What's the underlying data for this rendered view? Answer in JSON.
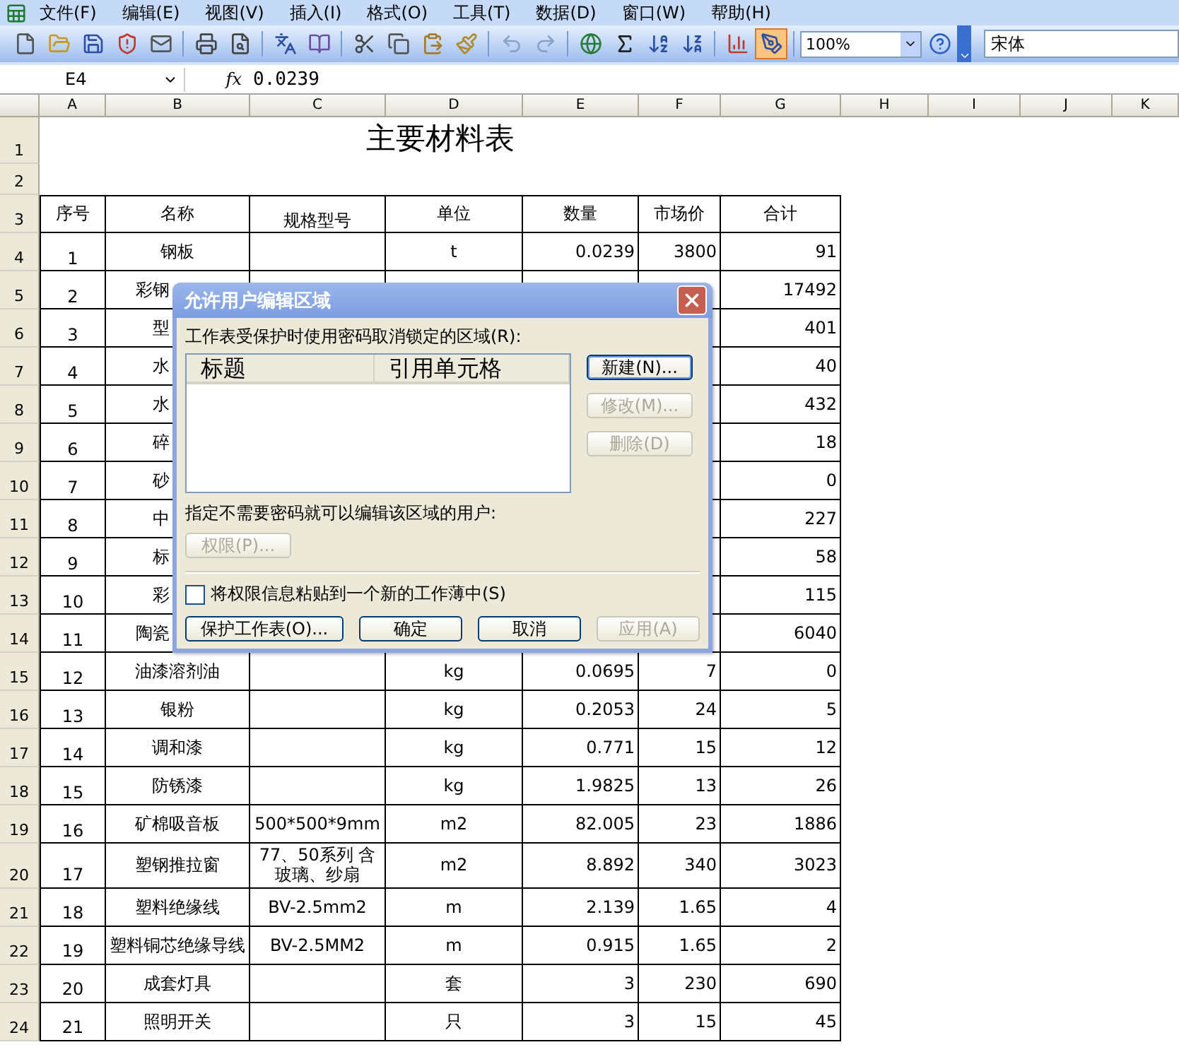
{
  "menu": [
    "文件(F)",
    "编辑(E)",
    "视图(V)",
    "插入(I)",
    "格式(O)",
    "工具(T)",
    "数据(D)",
    "窗口(W)",
    "帮助(H)"
  ],
  "toolbar": {
    "tools": [
      {
        "kind": "new",
        "pressed": false
      },
      {
        "kind": "open",
        "pressed": false
      },
      {
        "kind": "save",
        "pressed": false
      },
      {
        "kind": "permission",
        "pressed": false
      },
      {
        "kind": "mail",
        "pressed": false
      },
      {
        "kind": "print",
        "pressed": false
      },
      {
        "kind": "preview",
        "pressed": false
      },
      {
        "kind": "spelling",
        "pressed": false
      },
      {
        "kind": "research",
        "pressed": false
      },
      {
        "kind": "cut",
        "pressed": false
      },
      {
        "kind": "copy",
        "pressed": false
      },
      {
        "kind": "paste",
        "pressed": false
      },
      {
        "kind": "painter",
        "pressed": false
      },
      {
        "kind": "undo",
        "pressed": false
      },
      {
        "kind": "redo",
        "pressed": false
      },
      {
        "kind": "link",
        "pressed": false
      },
      {
        "kind": "sum",
        "pressed": false
      },
      {
        "kind": "sort_asc",
        "pressed": false
      },
      {
        "kind": "sort_desc",
        "pressed": false
      },
      {
        "kind": "chart",
        "pressed": false
      },
      {
        "kind": "drawing",
        "pressed": true
      }
    ],
    "zoom": "100%",
    "font": "宋体"
  },
  "formula_bar": {
    "cell": "E4",
    "function_label": "fx",
    "value": "0.0239"
  },
  "sheet": {
    "columns": [
      "A",
      "B",
      "C",
      "D",
      "E",
      "F",
      "G",
      "H",
      "I",
      "J",
      "K"
    ],
    "title": {
      "row": "1",
      "text": "主要材料表"
    },
    "blank_row": {
      "row": "2"
    },
    "header": {
      "row": "3",
      "cells": [
        "序号",
        "名称",
        "规格型号",
        "单位",
        "数量",
        "市场价",
        "合计"
      ]
    },
    "rows": [
      {
        "row": "4",
        "covered": false,
        "cells": [
          "1",
          "钢板",
          null,
          "t",
          "0.0239",
          "3800",
          "91"
        ]
      },
      {
        "row": "5",
        "covered": true,
        "cells": [
          "2",
          "彩钢",
          null,
          null,
          null,
          null,
          "17492"
        ]
      },
      {
        "row": "6",
        "covered": true,
        "cells": [
          "3",
          "型",
          null,
          null,
          null,
          null,
          "401"
        ]
      },
      {
        "row": "7",
        "covered": true,
        "cells": [
          "4",
          "水",
          null,
          null,
          null,
          null,
          "40"
        ]
      },
      {
        "row": "8",
        "covered": true,
        "cells": [
          "5",
          "水",
          null,
          null,
          null,
          null,
          "432"
        ]
      },
      {
        "row": "9",
        "covered": true,
        "cells": [
          "6",
          "碎",
          null,
          null,
          null,
          null,
          "18"
        ]
      },
      {
        "row": "10",
        "covered": true,
        "cells": [
          "7",
          "砂",
          null,
          null,
          null,
          null,
          "0"
        ]
      },
      {
        "row": "11",
        "covered": true,
        "cells": [
          "8",
          "中",
          null,
          null,
          null,
          null,
          "227"
        ]
      },
      {
        "row": "12",
        "covered": true,
        "cells": [
          "9",
          "标",
          null,
          null,
          null,
          null,
          "58"
        ]
      },
      {
        "row": "13",
        "covered": true,
        "cells": [
          "10",
          "彩",
          null,
          null,
          null,
          null,
          "115"
        ]
      },
      {
        "row": "14",
        "covered": true,
        "cells": [
          "11",
          "陶瓷",
          null,
          null,
          null,
          null,
          "6040"
        ]
      },
      {
        "row": "15",
        "covered": false,
        "cells": [
          "12",
          "油漆溶剂油",
          null,
          "kg",
          "0.0695",
          "7",
          "0"
        ]
      },
      {
        "row": "16",
        "covered": false,
        "cells": [
          "13",
          "银粉",
          null,
          "kg",
          "0.2053",
          "24",
          "5"
        ]
      },
      {
        "row": "17",
        "covered": false,
        "cells": [
          "14",
          "调和漆",
          null,
          "kg",
          "0.771",
          "15",
          "12"
        ]
      },
      {
        "row": "18",
        "covered": false,
        "cells": [
          "15",
          "防锈漆",
          null,
          "kg",
          "1.9825",
          "13",
          "26"
        ]
      },
      {
        "row": "19",
        "covered": false,
        "cells": [
          "16",
          "矿棉吸音板",
          "500*500*9mm",
          "m2",
          "82.005",
          "23",
          "1886"
        ]
      },
      {
        "row": "20",
        "covered": false,
        "cells": [
          "17",
          "塑钢推拉窗",
          "77、50系列 含玻璃、纱扇",
          "m2",
          "8.892",
          "340",
          "3023"
        ]
      },
      {
        "row": "21",
        "covered": false,
        "cells": [
          "18",
          "塑料绝缘线",
          "BV-2.5mm2",
          "m",
          "2.139",
          "1.65",
          "4"
        ]
      },
      {
        "row": "22",
        "covered": false,
        "cells": [
          "19",
          "塑料铜芯绝缘导线",
          "BV-2.5MM2",
          "m",
          "0.915",
          "1.65",
          "2"
        ]
      },
      {
        "row": "23",
        "covered": false,
        "cells": [
          "20",
          "成套灯具",
          null,
          "套",
          "3",
          "230",
          "690"
        ]
      },
      {
        "row": "24",
        "covered": false,
        "cells": [
          "21",
          "照明开关",
          null,
          "只",
          "3",
          "15",
          "45"
        ]
      }
    ]
  },
  "dialog": {
    "title": "允许用户编辑区域",
    "regions_label": "工作表受保护时使用密码取消锁定的区域(R):",
    "list_columns": [
      "标题",
      "引用单元格"
    ],
    "side_buttons": [
      {
        "label": "新建(N)...",
        "disabled": false
      },
      {
        "label": "修改(M)...",
        "disabled": true
      },
      {
        "label": "删除(D)",
        "disabled": true
      }
    ],
    "users_label": "指定不需要密码就可以编辑该区域的用户:",
    "permissions_button": {
      "label": "权限(P)...",
      "disabled": true
    },
    "checkbox": {
      "label": "将权限信息粘贴到一个新的工作薄中(S)",
      "checked": false
    },
    "buttons": [
      {
        "label": "保护工作表(O)...",
        "disabled": false
      },
      {
        "label": "确定",
        "disabled": false
      },
      {
        "label": "取消",
        "disabled": false
      },
      {
        "label": "应用(A)",
        "disabled": true
      }
    ]
  }
}
